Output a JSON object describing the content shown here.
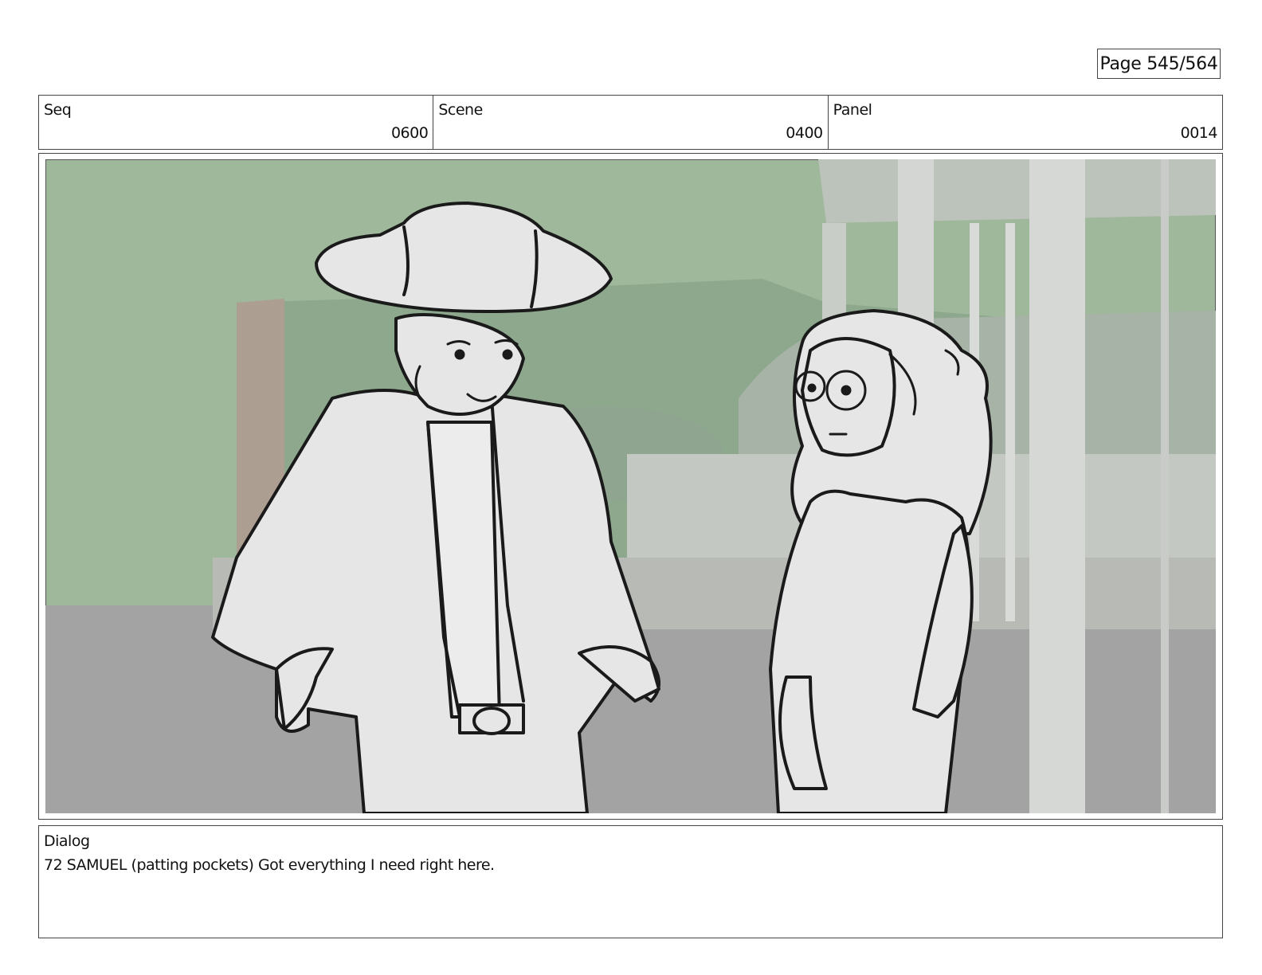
{
  "page": {
    "label": "Page 545/564"
  },
  "header": {
    "seq": {
      "label": "Seq",
      "value": "0600"
    },
    "scene": {
      "label": "Scene",
      "value": "0400"
    },
    "panel": {
      "label": "Panel",
      "value": "0014"
    }
  },
  "panel_image": {
    "description_icon": "storyboard-sketch-two-characters",
    "colors": {
      "sky": "#9fb79a",
      "hill": "#8aa58a",
      "ground": "#a9a9a9",
      "sketch_fill": "#e6e6e6",
      "line": "#1a1a1a"
    }
  },
  "dialog": {
    "label": "Dialog",
    "text": "72 SAMUEL (patting pockets) Got everything I need right here."
  }
}
